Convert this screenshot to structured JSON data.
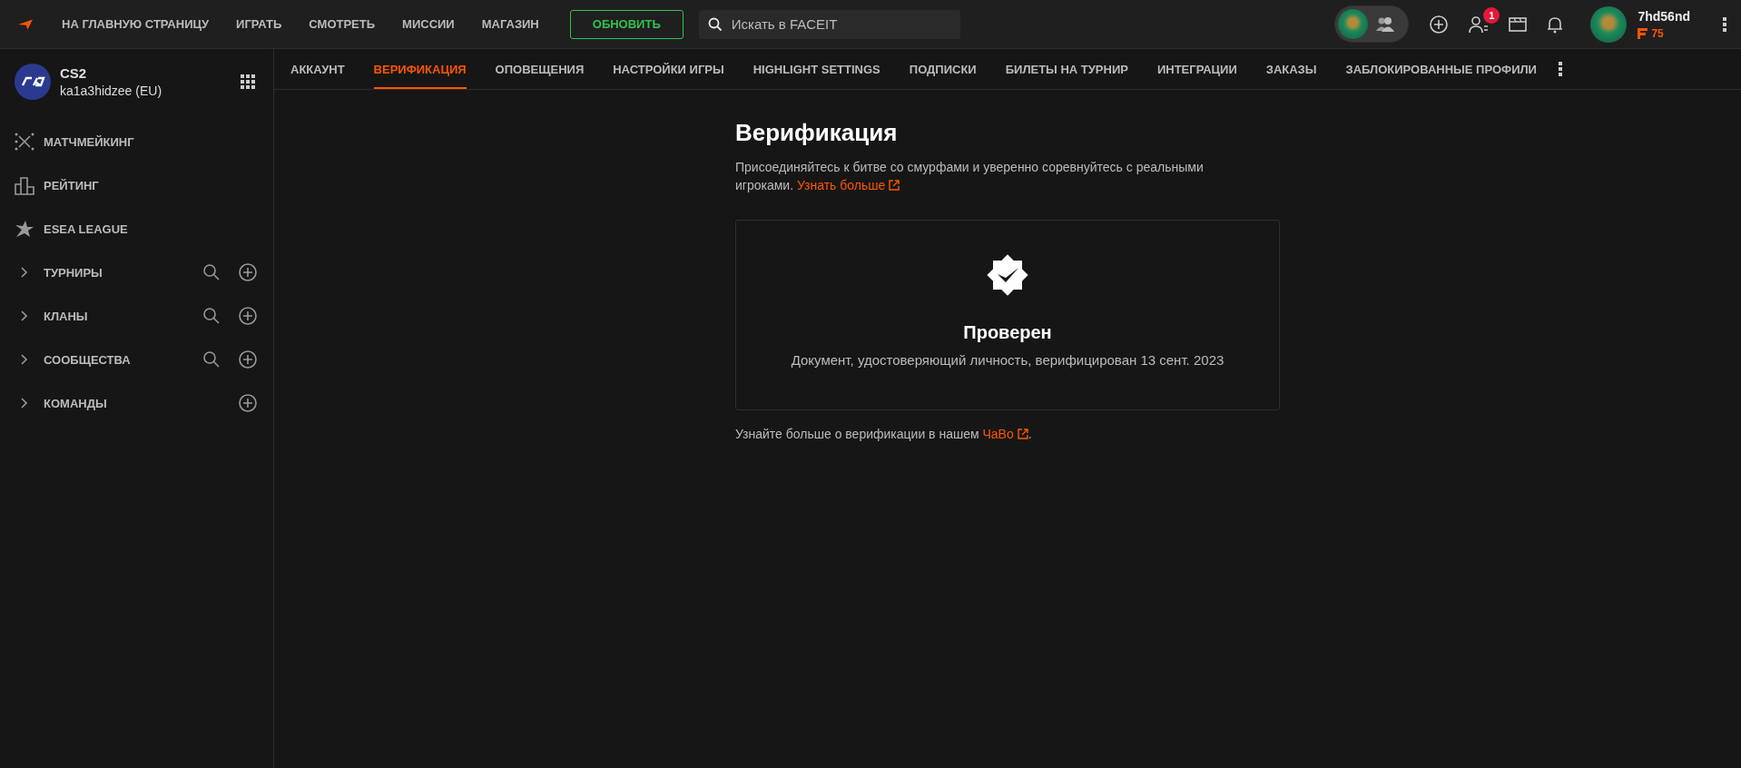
{
  "top_nav": {
    "items": [
      "НА ГЛАВНУЮ СТРАНИЦУ",
      "ИГРАТЬ",
      "СМОТРЕТЬ",
      "МИССИИ",
      "МАГАЗИН"
    ],
    "upgrade_button": "ОБНОВИТЬ",
    "search": {
      "placeholder": "Искать в FACEIT"
    },
    "friends_badge": "1",
    "party": {
      "open": true
    },
    "user": {
      "name": "7hd56nd",
      "points": "75"
    }
  },
  "sidebar": {
    "game": {
      "title": "CS2",
      "account": "ka1a3hidzee (EU)"
    },
    "items": [
      {
        "kind": "matchmaking",
        "label": "МАТЧМЕЙКИНГ"
      },
      {
        "kind": "ranking",
        "label": "РЕЙТИНГ"
      },
      {
        "kind": "league",
        "label": "ESEA LEAGUE"
      },
      {
        "kind": "group",
        "label": "ТУРНИРЫ",
        "expanded": false,
        "has_search": true
      },
      {
        "kind": "group",
        "label": "КЛАНЫ",
        "expanded": false,
        "has_search": true
      },
      {
        "kind": "group",
        "label": "СООБЩЕСТВА",
        "expanded": false,
        "has_search": true
      },
      {
        "kind": "group",
        "label": "КОМАНДЫ",
        "expanded": false,
        "has_search": false
      }
    ]
  },
  "tabs": [
    {
      "label": "АККАУНТ",
      "selected": false
    },
    {
      "label": "ВЕРИФИКАЦИЯ",
      "selected": true
    },
    {
      "label": "ОПОВЕЩЕНИЯ",
      "selected": false
    },
    {
      "label": "НАСТРОЙКИ ИГРЫ",
      "selected": false
    },
    {
      "label": "HIGHLIGHT SETTINGS",
      "selected": false
    },
    {
      "label": "ПОДПИСКИ",
      "selected": false
    },
    {
      "label": "БИЛЕТЫ НА ТУРНИР",
      "selected": false
    },
    {
      "label": "ИНТЕГРАЦИИ",
      "selected": false
    },
    {
      "label": "ЗАКАЗЫ",
      "selected": false
    },
    {
      "label": "ЗАБЛОКИРОВАННЫЕ ПРОФИЛИ",
      "selected": false
    }
  ],
  "verification": {
    "title": "Верификация",
    "intro": "Присоединяйтесь к битве со смурфами и уверенно соревнуйтесь с реальными игроками.",
    "intro_link": "Узнать больше",
    "status": {
      "verified": true,
      "title": "Проверен",
      "detail": "Документ, удостоверяющий личность, верифицирован 13 сент. 2023"
    },
    "faq_text": "Узнайте больше о верификации в нашем",
    "faq_link": "ЧаВо",
    "faq_end": "."
  }
}
